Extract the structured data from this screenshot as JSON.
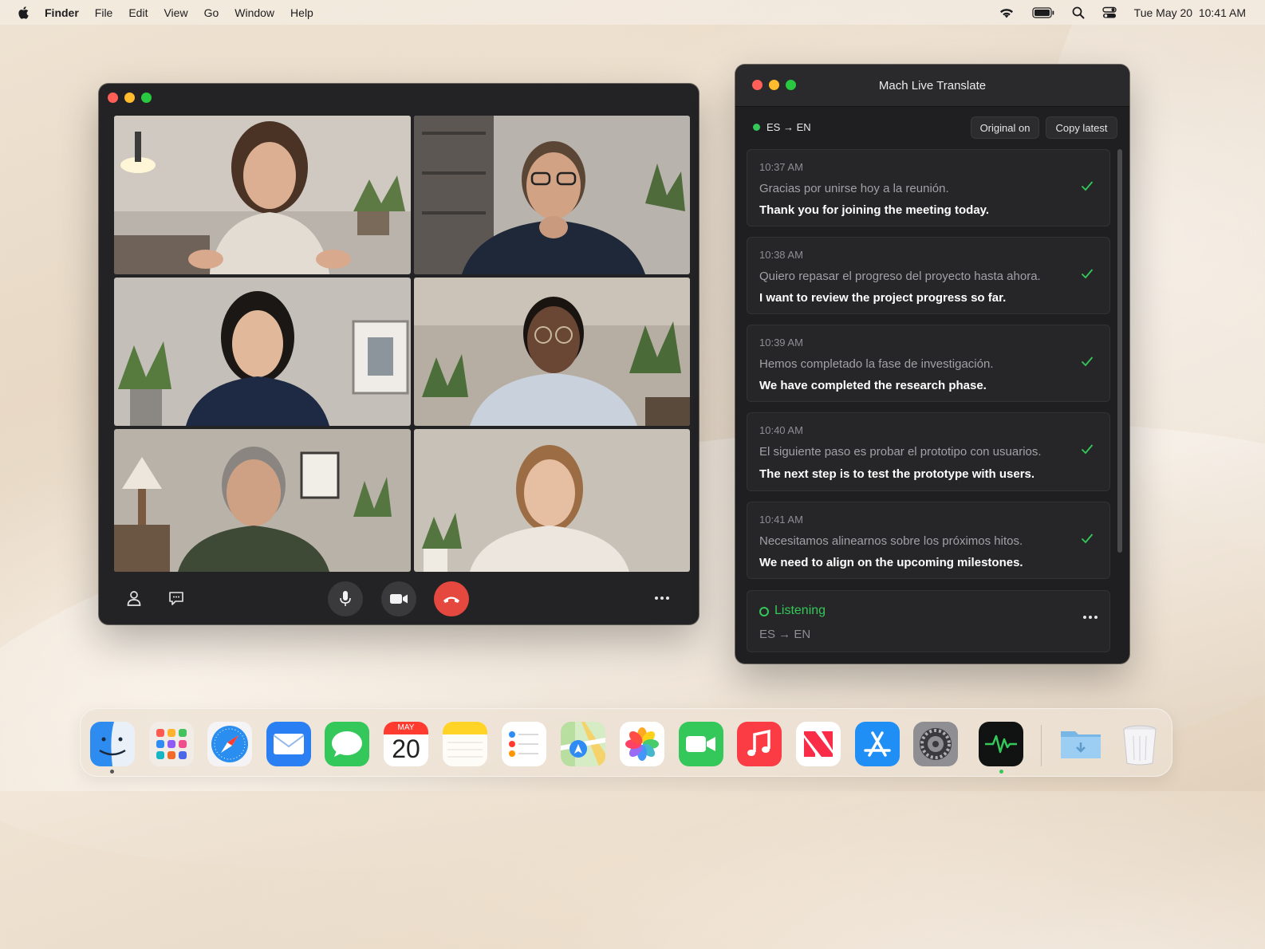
{
  "menubar": {
    "app": "Finder",
    "items": [
      "File",
      "Edit",
      "View",
      "Go",
      "Window",
      "Help"
    ],
    "date": "Tue May 20",
    "time": "10:41 AM"
  },
  "call": {
    "participants": [
      "participant-1",
      "participant-2",
      "participant-3",
      "participant-4",
      "participant-5",
      "participant-6"
    ]
  },
  "translate": {
    "title": "Mach Live Translate",
    "lang_pair": "ES → EN",
    "original_toggle": "Original on",
    "copy_latest": "Copy latest",
    "entries": [
      {
        "time": "10:37 AM",
        "original": "Gracias por unirse hoy a la reunión.",
        "translation": "Thank you for joining the meeting today."
      },
      {
        "time": "10:38 AM",
        "original": "Quiero repasar el progreso del proyecto hasta ahora.",
        "translation": "I want to review the project progress so far."
      },
      {
        "time": "10:39 AM",
        "original": "Hemos completado la fase de investigación.",
        "translation": "We have completed the research phase."
      },
      {
        "time": "10:40 AM",
        "original": "El siguiente paso es probar el prototipo con usuarios.",
        "translation": "The next step is to test the prototype with users."
      },
      {
        "time": "10:41 AM",
        "original": "Necesitamos alinearnos sobre los próximos hitos.",
        "translation": "We need to align on the upcoming milestones."
      }
    ],
    "status": "Listening",
    "status_lang": "ES → EN"
  },
  "dock": {
    "calendar_month": "MAY",
    "calendar_day": "20",
    "apps": [
      "finder",
      "launchpad",
      "safari",
      "mail",
      "messages",
      "calendar",
      "notes",
      "reminders",
      "maps",
      "photos",
      "facetime",
      "music",
      "news",
      "app-store",
      "system-settings",
      "activity-monitor",
      "downloads-folder",
      "trash"
    ]
  },
  "colors": {
    "accent_green": "#34c759",
    "end_call_red": "#e5483f",
    "window_bg": "#232325"
  }
}
